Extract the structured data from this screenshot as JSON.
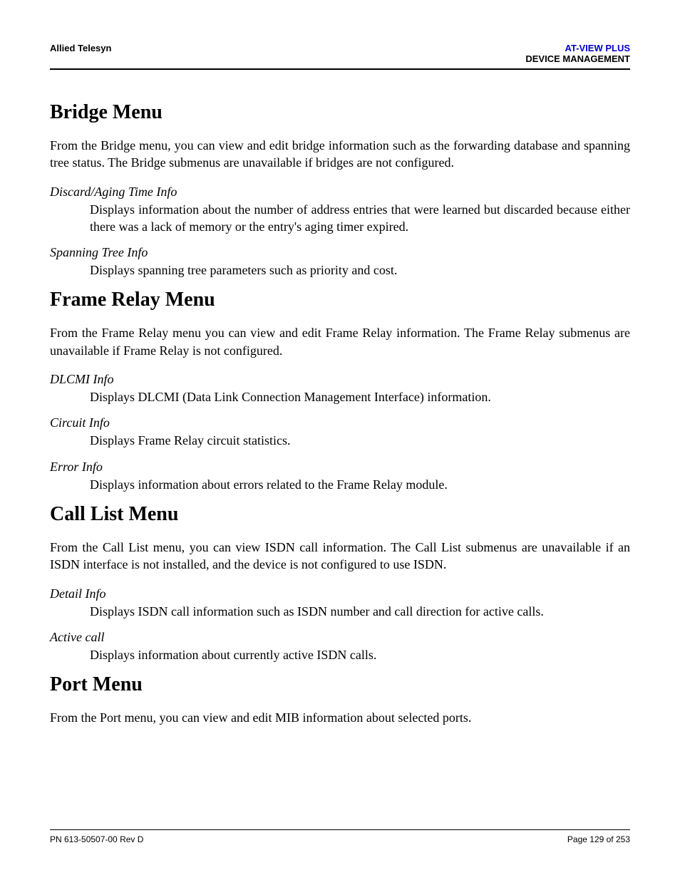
{
  "header": {
    "left": "Allied Telesyn",
    "right1": "AT-VIEW PLUS",
    "right2": "DEVICE MANAGEMENT"
  },
  "sections": {
    "bridge": {
      "heading": "Bridge Menu",
      "intro": "From the Bridge menu, you can view and edit bridge information such as the forwarding database and spanning tree status. The Bridge submenus are unavailable if bridges are not configured.",
      "items": [
        {
          "term": "Discard/Aging Time Info",
          "def": "Displays information about the number of address entries that were learned but discarded because either there was a lack of memory or the entry's aging timer expired."
        },
        {
          "term": "Spanning Tree Info",
          "def": "Displays spanning tree parameters such as priority and cost."
        }
      ]
    },
    "frameRelay": {
      "heading": "Frame Relay Menu",
      "intro": "From the Frame Relay menu you can view and edit Frame Relay information. The Frame Relay submenus are unavailable if Frame Relay is not configured.",
      "items": [
        {
          "term": "DLCMI Info",
          "def": "Displays DLCMI (Data Link Connection Management Interface) information."
        },
        {
          "term": "Circuit Info",
          "def": "Displays Frame Relay circuit statistics."
        },
        {
          "term": "Error Info",
          "def": "Displays information about errors related to the Frame Relay module."
        }
      ]
    },
    "callList": {
      "heading": "Call List Menu",
      "intro": "From the Call List menu, you can view ISDN call information. The Call List submenus are unavailable if an ISDN interface is not installed, and the device is not configured to use ISDN.",
      "items": [
        {
          "term": "Detail Info",
          "def": "Displays ISDN call information such as ISDN number and call direction for active calls."
        },
        {
          "term": "Active call",
          "def": "Displays information about currently active ISDN calls."
        }
      ]
    },
    "port": {
      "heading": "Port Menu",
      "intro": "From the Port menu, you can view and edit MIB information about selected ports."
    }
  },
  "footer": {
    "left": "PN 613-50507-00 Rev D",
    "right": "Page 129 of 253"
  }
}
